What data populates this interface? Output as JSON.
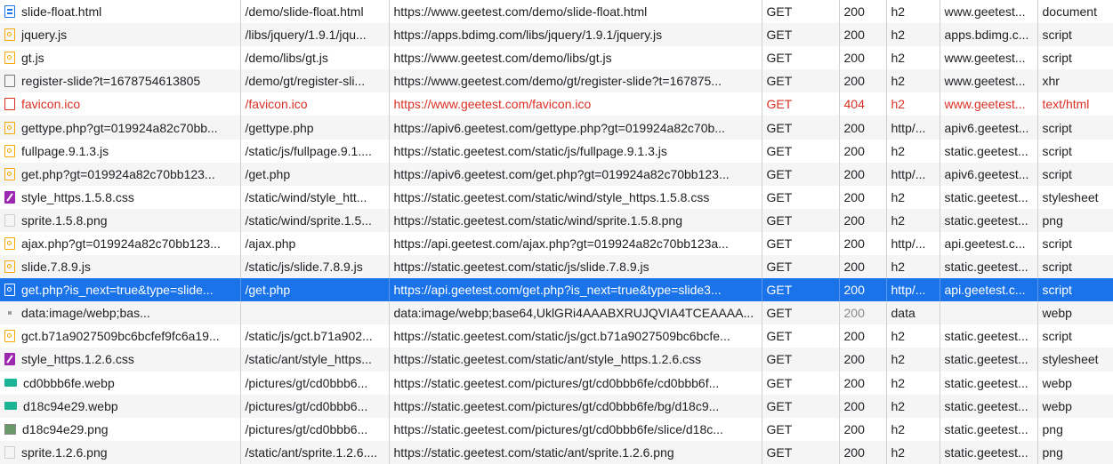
{
  "rows": [
    {
      "name": "slide-float.html",
      "icon": "document-icon",
      "path": "/demo/slide-float.html",
      "url": "https://www.geetest.com/demo/slide-float.html",
      "method": "GET",
      "status": "200",
      "protocol": "h2",
      "domain": "www.geetest...",
      "type": "document"
    },
    {
      "name": "jquery.js",
      "icon": "script-icon",
      "path": "/libs/jquery/1.9.1/jqu...",
      "url": "https://apps.bdimg.com/libs/jquery/1.9.1/jquery.js",
      "method": "GET",
      "status": "200",
      "protocol": "h2",
      "domain": "apps.bdimg.c...",
      "type": "script"
    },
    {
      "name": "gt.js",
      "icon": "script-icon",
      "path": "/demo/libs/gt.js",
      "url": "https://www.geetest.com/demo/libs/gt.js",
      "method": "GET",
      "status": "200",
      "protocol": "h2",
      "domain": "www.geetest...",
      "type": "script"
    },
    {
      "name": "register-slide?t=1678754613805",
      "icon": "xhr-icon",
      "path": "/demo/gt/register-sli...",
      "url": "https://www.geetest.com/demo/gt/register-slide?t=167875...",
      "method": "GET",
      "status": "200",
      "protocol": "h2",
      "domain": "www.geetest...",
      "type": "xhr"
    },
    {
      "name": "favicon.ico",
      "icon": "error-file-icon",
      "path": "/favicon.ico",
      "url": "https://www.geetest.com/favicon.ico",
      "method": "GET",
      "status": "404",
      "protocol": "h2",
      "domain": "www.geetest...",
      "type": "text/html",
      "error": true
    },
    {
      "name": "gettype.php?gt=019924a82c70bb...",
      "icon": "script-icon",
      "path": "/gettype.php",
      "url": "https://apiv6.geetest.com/gettype.php?gt=019924a82c70b...",
      "method": "GET",
      "status": "200",
      "protocol": "http/...",
      "domain": "apiv6.geetest...",
      "type": "script"
    },
    {
      "name": "fullpage.9.1.3.js",
      "icon": "script-icon",
      "path": "/static/js/fullpage.9.1....",
      "url": "https://static.geetest.com/static/js/fullpage.9.1.3.js",
      "method": "GET",
      "status": "200",
      "protocol": "h2",
      "domain": "static.geetest...",
      "type": "script"
    },
    {
      "name": "get.php?gt=019924a82c70bb123...",
      "icon": "script-icon",
      "path": "/get.php",
      "url": "https://apiv6.geetest.com/get.php?gt=019924a82c70bb123...",
      "method": "GET",
      "status": "200",
      "protocol": "http/...",
      "domain": "apiv6.geetest...",
      "type": "script"
    },
    {
      "name": "style_https.1.5.8.css",
      "icon": "stylesheet-icon",
      "path": "/static/wind/style_htt...",
      "url": "https://static.geetest.com/static/wind/style_https.1.5.8.css",
      "method": "GET",
      "status": "200",
      "protocol": "h2",
      "domain": "static.geetest...",
      "type": "stylesheet"
    },
    {
      "name": "sprite.1.5.8.png",
      "icon": "png-icon",
      "path": "/static/wind/sprite.1.5...",
      "url": "https://static.geetest.com/static/wind/sprite.1.5.8.png",
      "method": "GET",
      "status": "200",
      "protocol": "h2",
      "domain": "static.geetest...",
      "type": "png"
    },
    {
      "name": "ajax.php?gt=019924a82c70bb123...",
      "icon": "script-icon",
      "path": "/ajax.php",
      "url": "https://api.geetest.com/ajax.php?gt=019924a82c70bb123a...",
      "method": "GET",
      "status": "200",
      "protocol": "http/...",
      "domain": "api.geetest.c...",
      "type": "script"
    },
    {
      "name": "slide.7.8.9.js",
      "icon": "script-icon",
      "path": "/static/js/slide.7.8.9.js",
      "url": "https://static.geetest.com/static/js/slide.7.8.9.js",
      "method": "GET",
      "status": "200",
      "protocol": "h2",
      "domain": "static.geetest...",
      "type": "script"
    },
    {
      "name": "get.php?is_next=true&type=slide...",
      "icon": "script-icon",
      "path": "/get.php",
      "url": "https://api.geetest.com/get.php?is_next=true&type=slide3...",
      "method": "GET",
      "status": "200",
      "protocol": "http/...",
      "domain": "api.geetest.c...",
      "type": "script",
      "selected": true
    },
    {
      "name": "data:image/webp;bas...",
      "icon": "dot-icon",
      "path": "",
      "url": "data:image/webp;base64,UklGRi4AAABXRUJQVIA4TCEAAAA...",
      "method": "GET",
      "status": "200",
      "protocol": "data",
      "domain": "",
      "type": "webp",
      "status_muted": true
    },
    {
      "name": "gct.b71a9027509bc6bcfef9fc6a19...",
      "icon": "script-icon",
      "path": "/static/js/gct.b71a902...",
      "url": "https://static.geetest.com/static/js/gct.b71a9027509bc6bcfe...",
      "method": "GET",
      "status": "200",
      "protocol": "h2",
      "domain": "static.geetest...",
      "type": "script"
    },
    {
      "name": "style_https.1.2.6.css",
      "icon": "stylesheet-icon",
      "path": "/static/ant/style_https...",
      "url": "https://static.geetest.com/static/ant/style_https.1.2.6.css",
      "method": "GET",
      "status": "200",
      "protocol": "h2",
      "domain": "static.geetest...",
      "type": "stylesheet"
    },
    {
      "name": "cd0bbb6fe.webp",
      "icon": "webp-icon",
      "path": "/pictures/gt/cd0bbb6...",
      "url": "https://static.geetest.com/pictures/gt/cd0bbb6fe/cd0bbb6f...",
      "method": "GET",
      "status": "200",
      "protocol": "h2",
      "domain": "static.geetest...",
      "type": "webp"
    },
    {
      "name": "d18c94e29.webp",
      "icon": "webp-icon",
      "path": "/pictures/gt/cd0bbb6...",
      "url": "https://static.geetest.com/pictures/gt/cd0bbb6fe/bg/d18c9...",
      "method": "GET",
      "status": "200",
      "protocol": "h2",
      "domain": "static.geetest...",
      "type": "webp"
    },
    {
      "name": "d18c94e29.png",
      "icon": "image-thumbnail-icon",
      "path": "/pictures/gt/cd0bbb6...",
      "url": "https://static.geetest.com/pictures/gt/cd0bbb6fe/slice/d18c...",
      "method": "GET",
      "status": "200",
      "protocol": "h2",
      "domain": "static.geetest...",
      "type": "png"
    },
    {
      "name": "sprite.1.2.6.png",
      "icon": "png-icon",
      "path": "/static/ant/sprite.1.2.6....",
      "url": "https://static.geetest.com/static/ant/sprite.1.2.6.png",
      "method": "GET",
      "status": "200",
      "protocol": "h2",
      "domain": "static.geetest...",
      "type": "png"
    }
  ]
}
